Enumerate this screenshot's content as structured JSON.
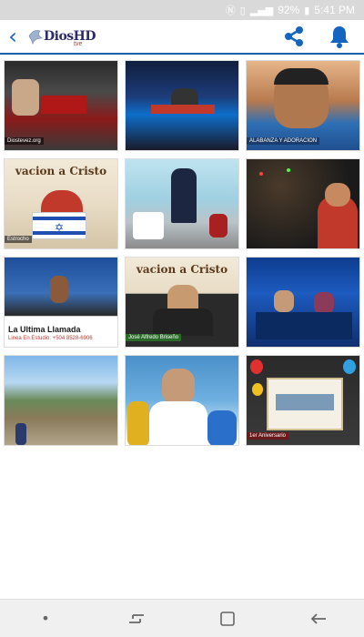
{
  "status_bar": {
    "battery": "92%",
    "time": "5:41 PM"
  },
  "header": {
    "logo_text": "DiosHD",
    "logo_subtext": "tve",
    "back_icon": "chevron-left-icon",
    "share_icon": "share-icon",
    "bell_icon": "bell-icon"
  },
  "tiles": [
    {
      "caption": "Diostevez.org"
    },
    {
      "caption": ""
    },
    {
      "caption": "ALABANZA Y ADORACION"
    },
    {
      "headline": "vacion a Cristo",
      "caption": "Estrocho"
    },
    {
      "caption": ""
    },
    {
      "caption": ""
    },
    {
      "caption": "La Ultima Llamada",
      "subcaption": "Linea En Estudio: +504 8528-6906"
    },
    {
      "headline": "vacion a Cristo",
      "caption": "José Alfredo Briseño"
    },
    {
      "caption": ""
    },
    {
      "caption": ""
    },
    {
      "caption": ""
    },
    {
      "caption": "1er Aniversario"
    }
  ],
  "colors": {
    "accent": "#1565c0",
    "header_border": "#1f5fb0",
    "status_bar": "#d9d9d9"
  }
}
